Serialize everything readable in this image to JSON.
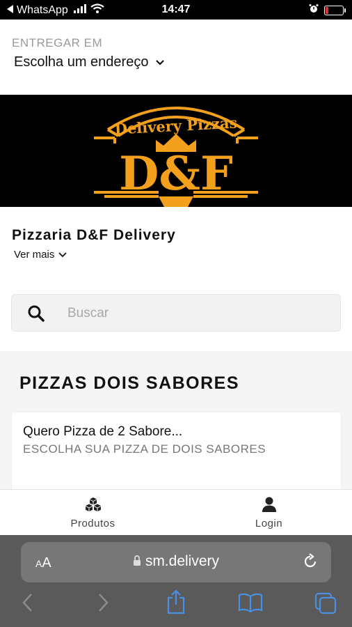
{
  "status_bar": {
    "back_app": "WhatsApp",
    "time": "14:47"
  },
  "delivery": {
    "label": "ENTREGAR EM",
    "address_selector": "Escolha um endereço"
  },
  "banner": {
    "logo_top_text": "Delivery Pizzas",
    "logo_main_text": "D&F",
    "brand_color": "#f3a11c"
  },
  "store": {
    "name": "Pizzaria D&F Delivery",
    "more_label": "Ver mais"
  },
  "search": {
    "placeholder": "Buscar",
    "value": ""
  },
  "section": {
    "title": "PIZZAS DOIS SABORES",
    "items": [
      {
        "title": "Quero Pizza de 2 Sabore...",
        "subtitle": "ESCOLHA SUA PIZZA DE DOIS SABORES"
      }
    ]
  },
  "tab_bar": {
    "tabs": [
      {
        "label": "Produtos",
        "icon": "cubes-icon"
      },
      {
        "label": "Login",
        "icon": "user-icon"
      }
    ]
  },
  "browser": {
    "text_size_label": "AA",
    "url": "sm.delivery"
  },
  "colors": {
    "accent": "#f3a11c",
    "browser_bar": "#5a5a5a",
    "ios_blue": "#4a90e2"
  }
}
